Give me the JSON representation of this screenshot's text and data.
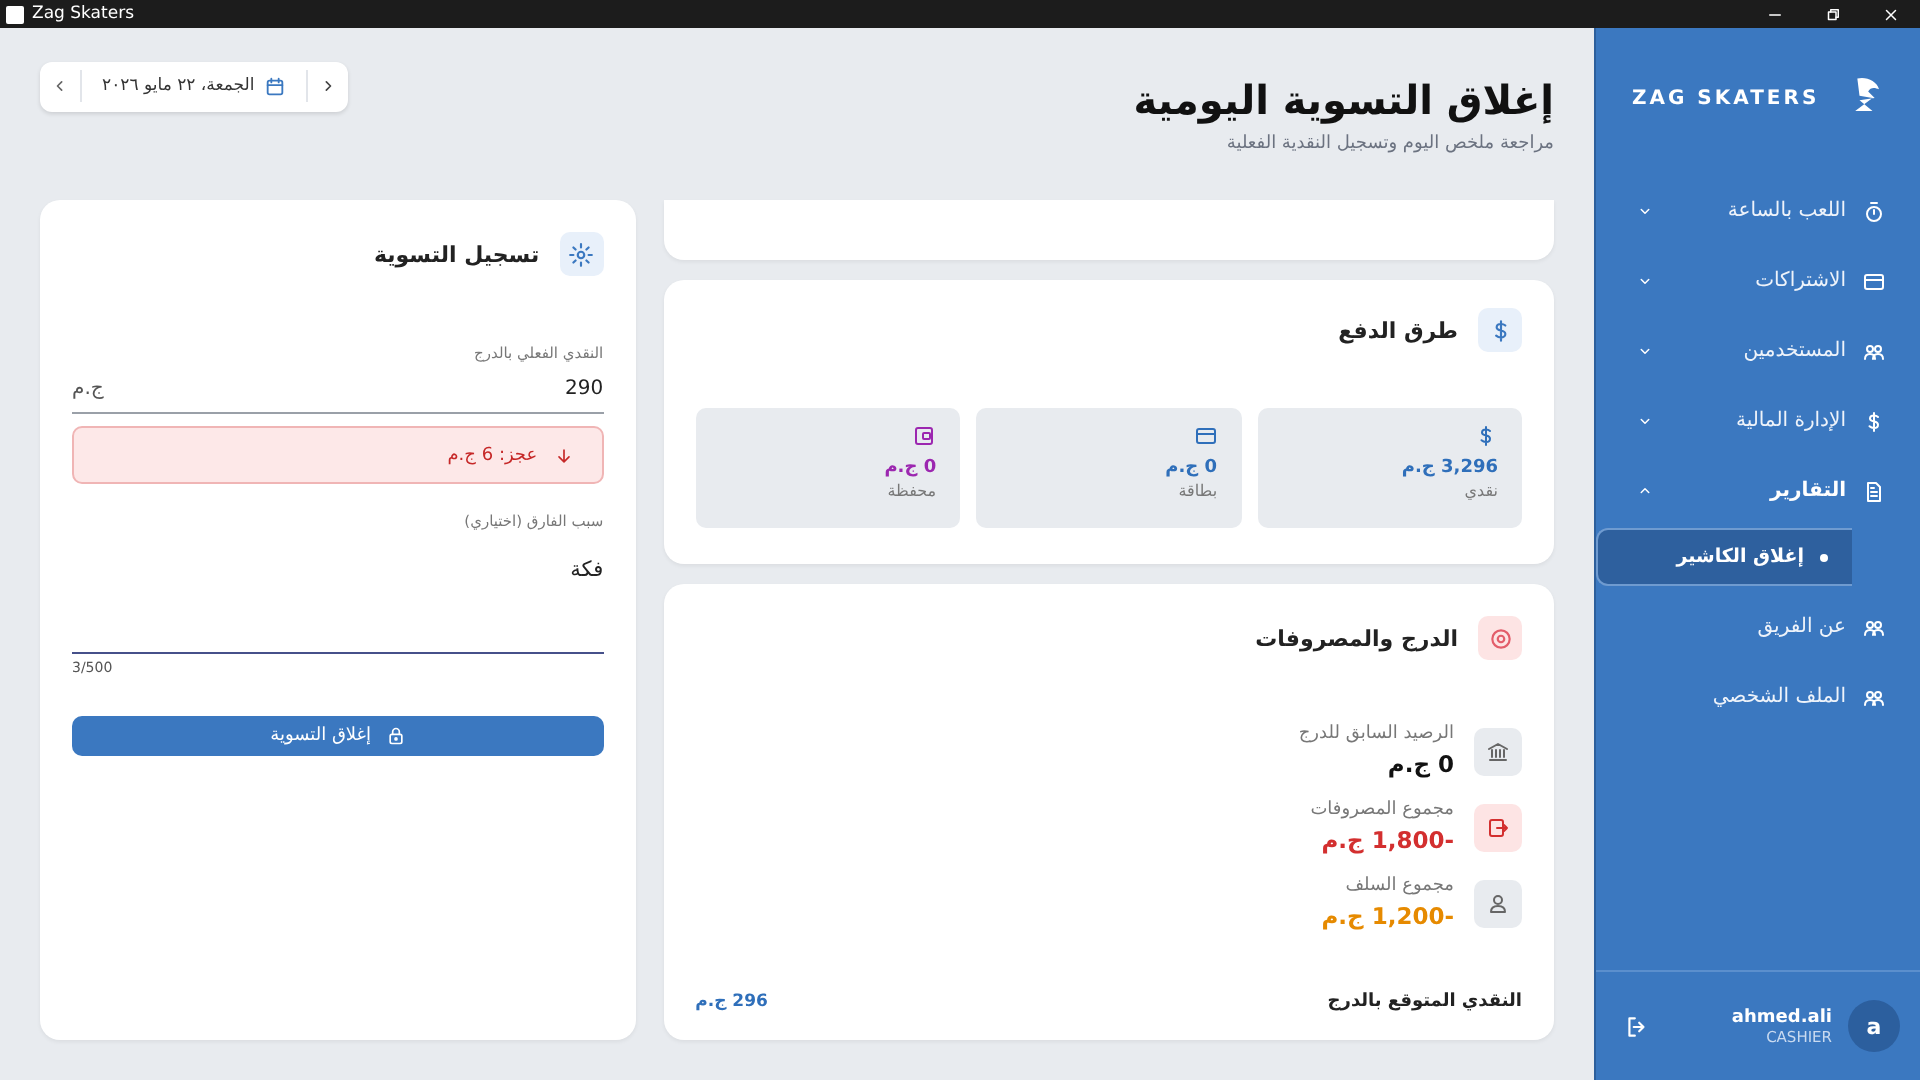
{
  "window": {
    "title": "Zag Skaters"
  },
  "sidebar": {
    "brand": "ZAG SKATERS",
    "items": [
      {
        "kind": "group",
        "label": "اللعب بالساعة",
        "expanded": false
      },
      {
        "kind": "group",
        "label": "الاشتراكات",
        "expanded": false
      },
      {
        "kind": "group",
        "label": "المستخدمين",
        "expanded": false
      },
      {
        "kind": "group",
        "label": "الإدارة المالية",
        "expanded": false
      },
      {
        "kind": "group",
        "label": "التقارير",
        "expanded": true,
        "children": [
          {
            "label": "إغلاق الكاشير",
            "selected": true
          }
        ]
      },
      {
        "kind": "link",
        "label": "عن الفريق"
      },
      {
        "kind": "link",
        "label": "الملف الشخصي"
      }
    ],
    "user": {
      "name": "ahmed.ali",
      "role": "CASHIER",
      "avatar_letter": "a"
    }
  },
  "header": {
    "title": "إغلاق التسوية اليومية",
    "subtitle": "مراجعة ملخص اليوم وتسجيل النقدية الفعلية",
    "date": "الجمعة، ٢٢ مايو ٢٠٢٦"
  },
  "payment_methods": {
    "title": "طرق الدفع",
    "items": [
      {
        "kind": "cash",
        "label": "نقدي",
        "amount": "3,296 ج.م",
        "color": "#2f6fba"
      },
      {
        "kind": "card",
        "label": "بطاقة",
        "amount": "0 ج.م",
        "color": "#2f6fba"
      },
      {
        "kind": "wallet",
        "label": "محفظة",
        "amount": "0 ج.م",
        "color": "#9c27b0"
      }
    ]
  },
  "drawer": {
    "title": "الدرج والمصروفات",
    "rows": [
      {
        "kind": "balance",
        "label": "الرصيد السابق للدرج",
        "amount": "0 ج.م",
        "color": "#111111"
      },
      {
        "kind": "expense",
        "label": "مجموع المصروفات",
        "amount": "-1,800 ج.م",
        "color": "#d32f2f"
      },
      {
        "kind": "advance",
        "label": "مجموع السلف",
        "amount": "-1,200 ج.م",
        "color": "#e68a00"
      }
    ],
    "expected_label": "النقدي المتوقع بالدرج",
    "expected_amount": "296 ج.م"
  },
  "settlement": {
    "title": "تسجيل التسوية",
    "cash_label": "النقدي الفعلي بالدرج",
    "cash_value": "290",
    "currency": "ج.م",
    "difference": {
      "kind": "deficit",
      "text": "عجز: 6 ج.م"
    },
    "reason_label": "سبب الفارق (اختياري)",
    "reason_value": "فكة",
    "counter": "3/500",
    "submit": "إغلاق التسوية"
  }
}
